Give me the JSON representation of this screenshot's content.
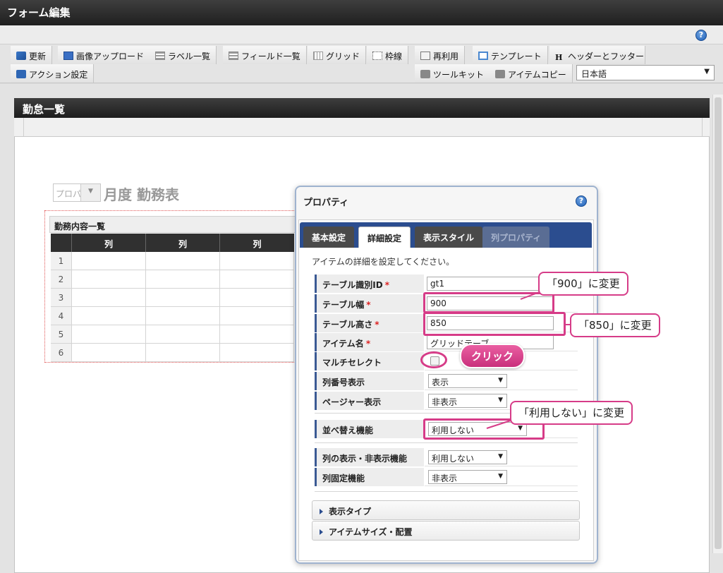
{
  "app": {
    "title": "フォーム編集"
  },
  "icons": {
    "help": "?"
  },
  "toolbar": {
    "row1": [
      "更新",
      "画像アップロード",
      "ラベル一覧",
      "フィールド一覧",
      "グリッド",
      "枠線",
      "再利用",
      "テンプレート",
      "ヘッダーとフッター"
    ],
    "row2_left": "アクション設定",
    "toolkit": "ツールキット",
    "item_copy": "アイテムコピー",
    "language": "日本語"
  },
  "form": {
    "title": "勤怠一覧",
    "month_select": "プロパ",
    "month_title": "月度 勤務表",
    "grid": {
      "caption": "勤務内容一覧",
      "columns": [
        "列",
        "列",
        "列"
      ],
      "rows": [
        "1",
        "2",
        "3",
        "4",
        "5",
        "6"
      ]
    }
  },
  "dialog": {
    "title": "プロパティ",
    "tabs": [
      "基本設定",
      "詳細設定",
      "表示スタイル",
      "列プロパティ"
    ],
    "instruction": "アイテムの詳細を設定してください。",
    "fields": {
      "table_id": {
        "label": "テーブル識別ID",
        "required": "*",
        "value": "gt1"
      },
      "table_width": {
        "label": "テーブル幅",
        "required": "*",
        "value": "900"
      },
      "table_height": {
        "label": "テーブル高さ",
        "required": "*",
        "value": "850"
      },
      "item_name": {
        "label": "アイテム名",
        "required": "*",
        "value": "グリッドテーブ"
      },
      "multi_select": {
        "label": "マルチセレクト"
      },
      "row_number": {
        "label": "列番号表示",
        "value": "表示"
      },
      "pager": {
        "label": "ページャー表示",
        "value": "非表示"
      },
      "sort": {
        "label": "並べ替え機能",
        "value": "利用しない"
      },
      "col_visibility": {
        "label": "列の表示・非表示機能",
        "value": "利用しない"
      },
      "col_fixed": {
        "label": "列固定機能",
        "value": "非表示"
      }
    },
    "sections": [
      "表示タイプ",
      "アイテムサイズ・配置"
    ]
  },
  "annotations": {
    "width": "「900」に変更",
    "height": "「850」に変更",
    "click": "クリック",
    "sort": "「利用しない」に変更",
    "accent_color": "#d63c88"
  }
}
